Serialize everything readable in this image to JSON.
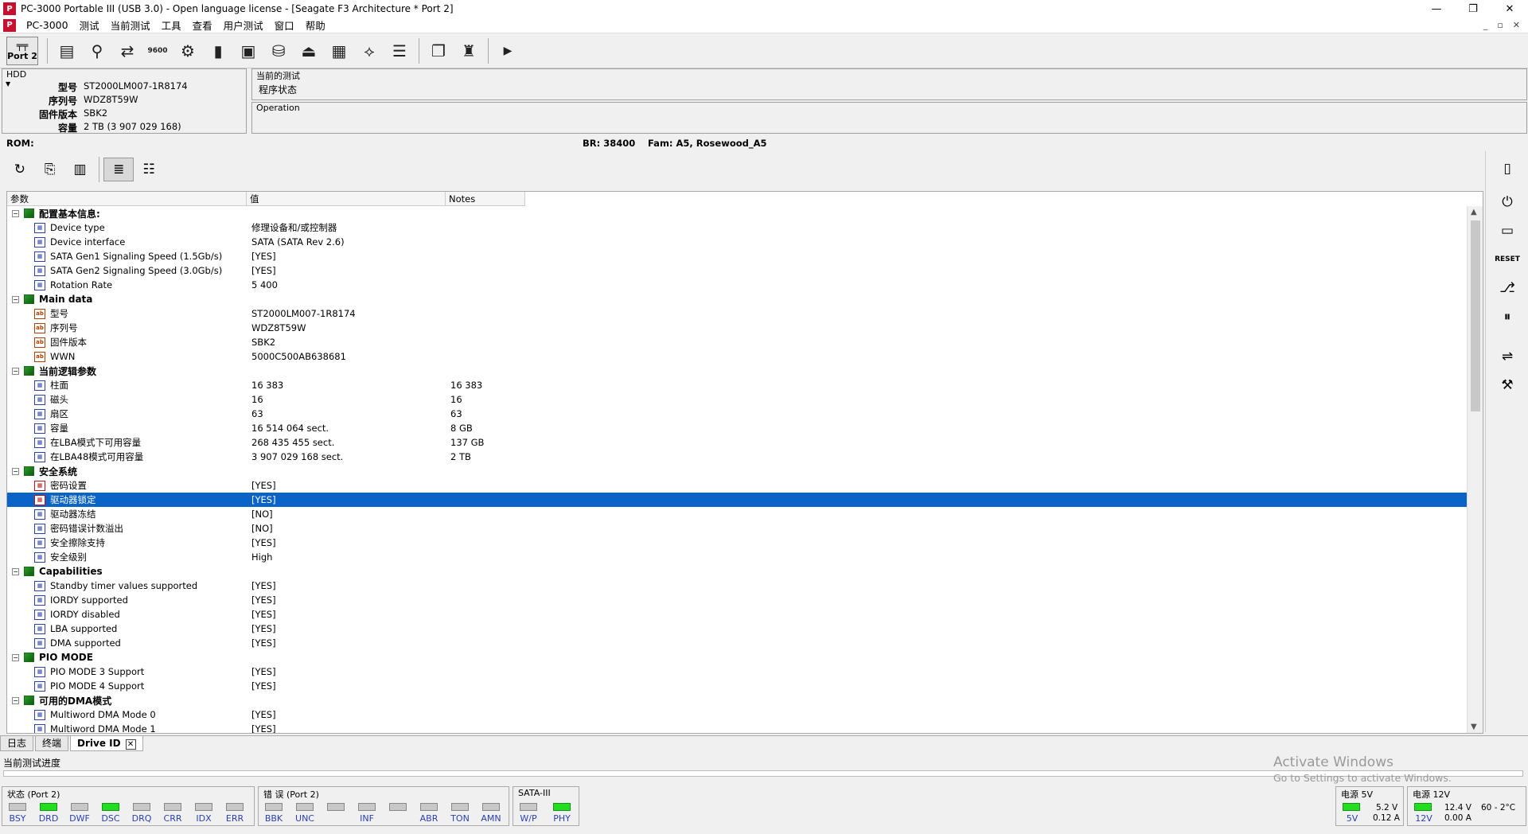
{
  "window": {
    "title": "PC-3000 Portable III (USB 3.0) - Open language license - [Seagate F3 Architecture * Port 2]",
    "app_icon": "pc3000-logo-icon",
    "minimize": "—",
    "maximize": "❐",
    "close": "✕"
  },
  "menu": {
    "items": [
      "PC-3000",
      "测试",
      "当前测试",
      "工具",
      "查看",
      "用户测试",
      "窗口",
      "帮助"
    ],
    "mdi_min": "_",
    "mdi_restore": "▫",
    "mdi_close": "✕"
  },
  "toolbar": {
    "port_label": "Port 2",
    "icons": [
      "drive-icon",
      "search-icon",
      "transfer-icon",
      "speed-icon",
      "settings-gear-icon",
      "chip-icon",
      "drive-select-icon",
      "disk-icon",
      "power-icon",
      "grid-icon",
      "network-icon",
      "list-icon",
      "copy-icon",
      "person-icon",
      "play-icon"
    ]
  },
  "hdd": {
    "label": "HDD",
    "fields": [
      {
        "k": "型号",
        "v": "ST2000LM007-1R8174"
      },
      {
        "k": "序列号",
        "v": "WDZ8T59W"
      },
      {
        "k": "固件版本",
        "v": "SBK2"
      },
      {
        "k": "容量",
        "v": "2 TB (3 907 029 168)"
      }
    ]
  },
  "current_test": {
    "label": "当前的测试",
    "value": "程序状态"
  },
  "operation": {
    "label": "Operation"
  },
  "rom_bar": {
    "rom": "ROM:",
    "br": "BR: 38400",
    "fam": "Fam: A5, Rosewood_A5"
  },
  "table": {
    "headers": [
      "参数",
      "值",
      "Notes"
    ],
    "rows": [
      {
        "type": "group",
        "label": "配置基本信息:"
      },
      {
        "type": "item",
        "icon": "reg",
        "label": "Device type",
        "value": "修理设备和/或控制器",
        "note": ""
      },
      {
        "type": "item",
        "icon": "reg",
        "label": "Device interface",
        "value": "SATA (SATA Rev 2.6)",
        "note": ""
      },
      {
        "type": "item",
        "icon": "reg",
        "label": "SATA Gen1 Signaling Speed (1.5Gb/s)",
        "value": "[YES]",
        "note": ""
      },
      {
        "type": "item",
        "icon": "reg",
        "label": "SATA Gen2 Signaling Speed (3.0Gb/s)",
        "value": "[YES]",
        "note": ""
      },
      {
        "type": "item",
        "icon": "reg",
        "label": "Rotation Rate",
        "value": "5 400",
        "note": ""
      },
      {
        "type": "group",
        "label": "Main data"
      },
      {
        "type": "item",
        "icon": "ab",
        "label": "型号",
        "value": "ST2000LM007-1R8174",
        "note": ""
      },
      {
        "type": "item",
        "icon": "ab",
        "label": "序列号",
        "value": "WDZ8T59W",
        "note": ""
      },
      {
        "type": "item",
        "icon": "ab",
        "label": "固件版本",
        "value": "SBK2",
        "note": ""
      },
      {
        "type": "item",
        "icon": "ab",
        "label": "WWN",
        "value": "5000C500AB638681",
        "note": ""
      },
      {
        "type": "group",
        "label": "当前逻辑参数"
      },
      {
        "type": "item",
        "icon": "reg",
        "label": "柱面",
        "value": "16 383",
        "note": "16 383"
      },
      {
        "type": "item",
        "icon": "reg",
        "label": "磁头",
        "value": "16",
        "note": "16"
      },
      {
        "type": "item",
        "icon": "reg",
        "label": "扇区",
        "value": "63",
        "note": "63"
      },
      {
        "type": "item",
        "icon": "reg",
        "label": "容量",
        "value": "16 514 064 sect.",
        "note": "8 GB"
      },
      {
        "type": "item",
        "icon": "reg",
        "label": "在LBA模式下可用容量",
        "value": "268 435 455 sect.",
        "note": "137 GB"
      },
      {
        "type": "item",
        "icon": "reg",
        "label": "在LBA48模式可用容量",
        "value": "3 907 029 168 sect.",
        "note": "2 TB"
      },
      {
        "type": "group",
        "label": "安全系统"
      },
      {
        "type": "item",
        "icon": "red",
        "label": "密码设置",
        "value": "[YES]",
        "note": ""
      },
      {
        "type": "item",
        "icon": "red",
        "label": "驱动器锁定",
        "value": "[YES]",
        "note": "",
        "selected": true
      },
      {
        "type": "item",
        "icon": "reg",
        "label": "驱动器冻结",
        "value": "[NO]",
        "note": ""
      },
      {
        "type": "item",
        "icon": "reg",
        "label": "密码错误计数溢出",
        "value": "[NO]",
        "note": ""
      },
      {
        "type": "item",
        "icon": "reg",
        "label": "安全擦除支持",
        "value": "[YES]",
        "note": ""
      },
      {
        "type": "item",
        "icon": "reg",
        "label": "安全级别",
        "value": "High",
        "note": ""
      },
      {
        "type": "group",
        "label": "Capabilities"
      },
      {
        "type": "item",
        "icon": "reg",
        "label": "Standby timer values supported",
        "value": "[YES]",
        "note": ""
      },
      {
        "type": "item",
        "icon": "reg",
        "label": "IORDY supported",
        "value": "[YES]",
        "note": ""
      },
      {
        "type": "item",
        "icon": "reg",
        "label": "IORDY disabled",
        "value": "[YES]",
        "note": ""
      },
      {
        "type": "item",
        "icon": "reg",
        "label": "LBA supported",
        "value": "[YES]",
        "note": ""
      },
      {
        "type": "item",
        "icon": "reg",
        "label": "DMA supported",
        "value": "[YES]",
        "note": ""
      },
      {
        "type": "group",
        "label": "PIO MODE"
      },
      {
        "type": "item",
        "icon": "reg",
        "label": "PIO MODE 3 Support",
        "value": "[YES]",
        "note": ""
      },
      {
        "type": "item",
        "icon": "reg",
        "label": "PIO MODE 4 Support",
        "value": "[YES]",
        "note": ""
      },
      {
        "type": "group",
        "label": "可用的DMA模式"
      },
      {
        "type": "item",
        "icon": "reg",
        "label": "Multiword DMA Mode 0",
        "value": "[YES]",
        "note": ""
      },
      {
        "type": "item",
        "icon": "reg",
        "label": "Multiword DMA Mode 1",
        "value": "[YES]",
        "note": ""
      }
    ]
  },
  "tabs": [
    {
      "label": "日志",
      "active": false
    },
    {
      "label": "终端",
      "active": false
    },
    {
      "label": "Drive ID",
      "active": true
    }
  ],
  "tab_close": "✕",
  "progress": {
    "label": "当前测试进度"
  },
  "watermark": {
    "line1": "Activate Windows",
    "line2": "Go to Settings to activate Windows."
  },
  "status": {
    "label": "状态 (Port 2)",
    "leds": [
      {
        "name": "BSY",
        "on": false
      },
      {
        "name": "DRD",
        "on": true
      },
      {
        "name": "DWF",
        "on": false
      },
      {
        "name": "DSC",
        "on": true
      },
      {
        "name": "DRQ",
        "on": false
      },
      {
        "name": "CRR",
        "on": false
      },
      {
        "name": "IDX",
        "on": false
      },
      {
        "name": "ERR",
        "on": false
      }
    ]
  },
  "errors": {
    "label": "错 误 (Port 2)",
    "leds": [
      {
        "name": "BBK",
        "on": false
      },
      {
        "name": "UNC",
        "on": false
      },
      {
        "name": "",
        "on": false
      },
      {
        "name": "INF",
        "on": false
      },
      {
        "name": "",
        "on": false
      },
      {
        "name": "ABR",
        "on": false
      },
      {
        "name": "TON",
        "on": false
      },
      {
        "name": "AMN",
        "on": false
      }
    ]
  },
  "sata": {
    "label": "SATA-III",
    "leds": [
      {
        "name": "W/P",
        "on": false
      },
      {
        "name": "PHY",
        "on": true
      }
    ]
  },
  "power5": {
    "label": "电源 5V",
    "led": "5V",
    "volt": "5.2 V",
    "amp": "0.12 A"
  },
  "power12": {
    "label": "电源 12V",
    "led": "12V",
    "volt": "12.4 V",
    "amp": "0.00 A",
    "temp": "60 - 2°C"
  },
  "colors": {
    "accent": "#0a64c8",
    "led_on": "#22dd22"
  }
}
